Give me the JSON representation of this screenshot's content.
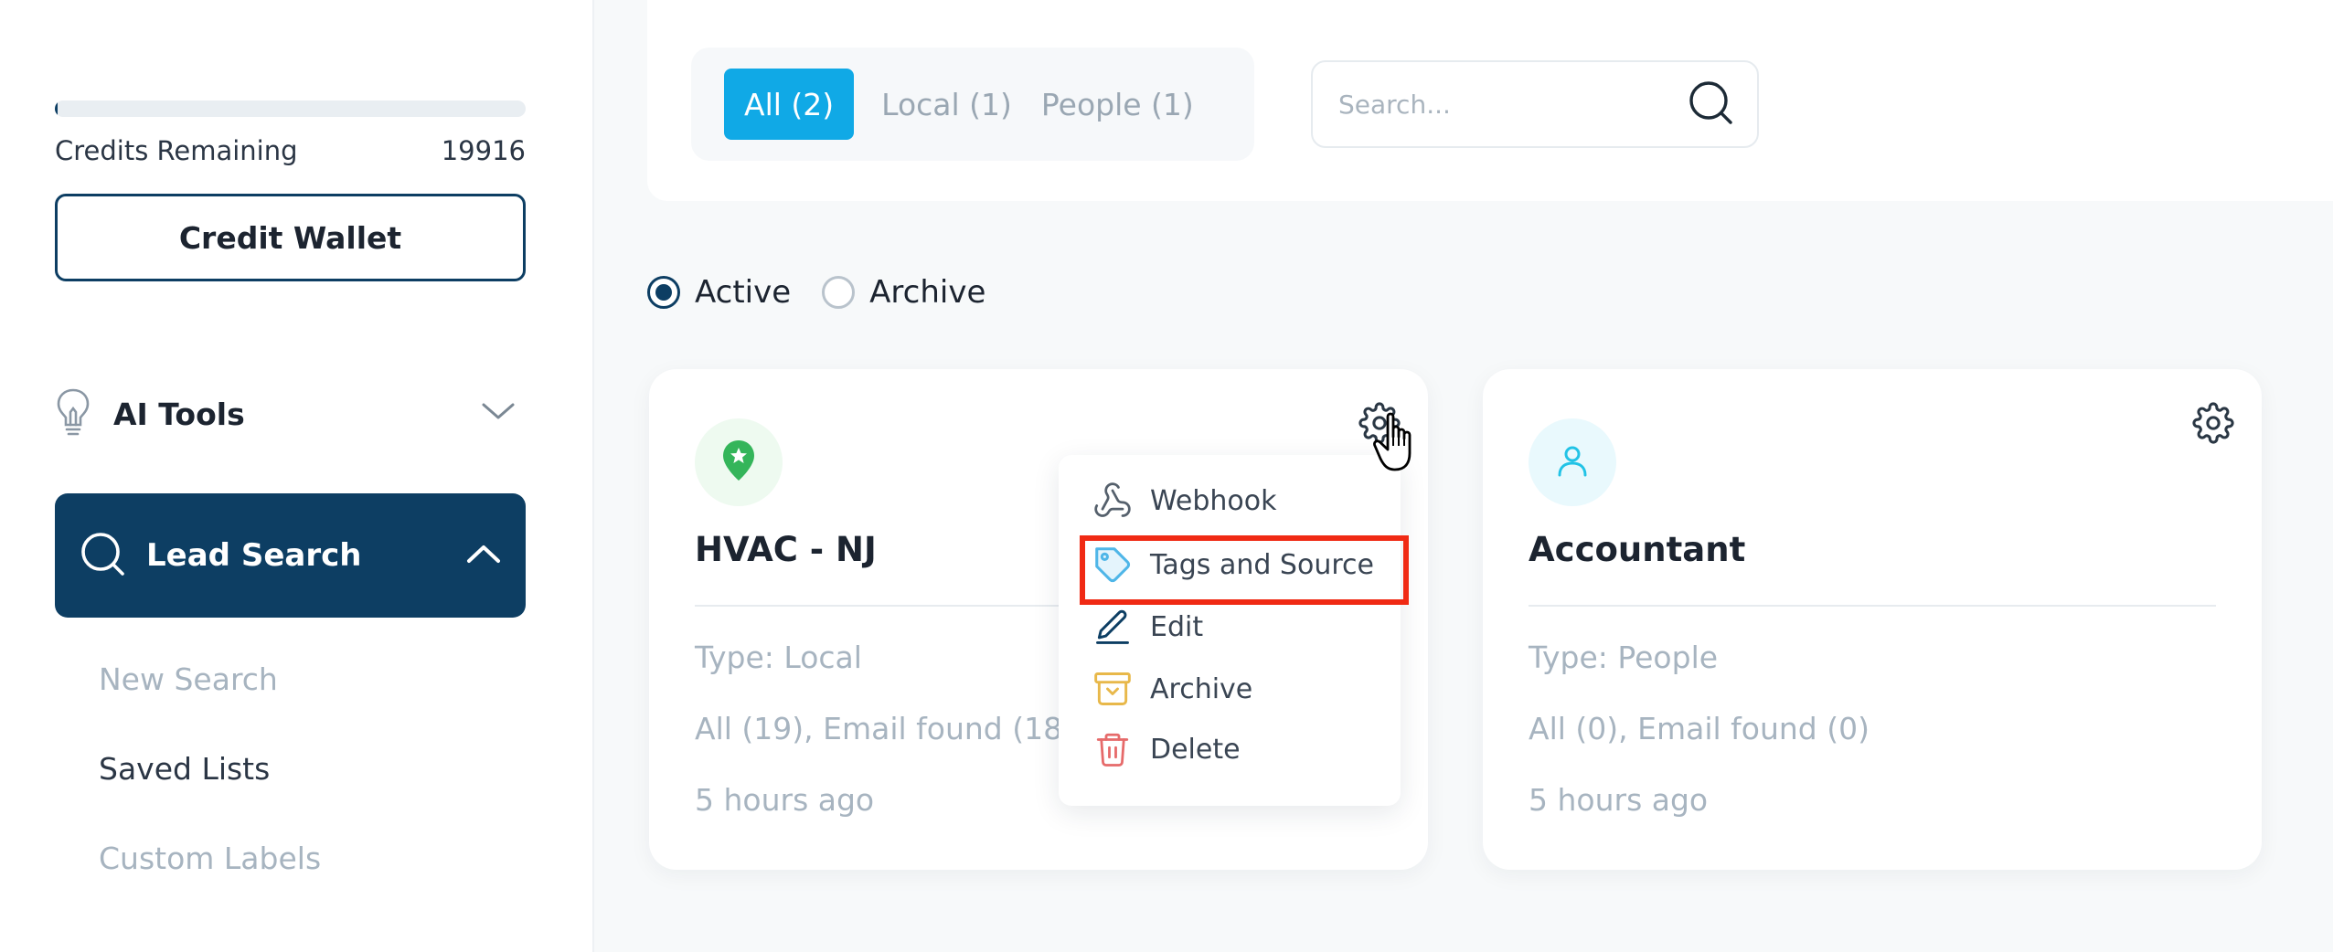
{
  "sidebar": {
    "credits_fraction": 0.005,
    "credits_label": "Credits Remaining",
    "credits_value": "19916",
    "credit_wallet_label": "Credit Wallet",
    "ai_tools_label": "AI Tools",
    "lead_search_label": "Lead Search",
    "subnav": [
      "New Search",
      "Saved Lists",
      "Custom Labels"
    ]
  },
  "tabs": [
    "All (2)",
    "Local (1)",
    "People (1)"
  ],
  "active_tab": "All (2)",
  "search": {
    "placeholder": "Search..."
  },
  "filters": {
    "active_label": "Active",
    "archive_label": "Archive",
    "selected": "Active"
  },
  "cards": [
    {
      "title": "HVAC - NJ",
      "type": "Type: Local",
      "counts": "All (19), Email found (18)",
      "time": "5 hours ago",
      "icon": "map-pin-icon",
      "accent": "#34b55a"
    },
    {
      "title": "Accountant",
      "type": "Type: People",
      "counts": "All (0), Email found (0)",
      "time": "5 hours ago",
      "icon": "person-icon",
      "accent": "#22c3e6"
    }
  ],
  "dropdown": {
    "items": [
      "Webhook",
      "Tags and Source",
      "Edit",
      "Archive",
      "Delete"
    ],
    "highlighted": "Tags and Source"
  },
  "colors": {
    "primary": "#0d3e63",
    "tab_active": "#10a9e6",
    "highlight": "#f02a14"
  }
}
